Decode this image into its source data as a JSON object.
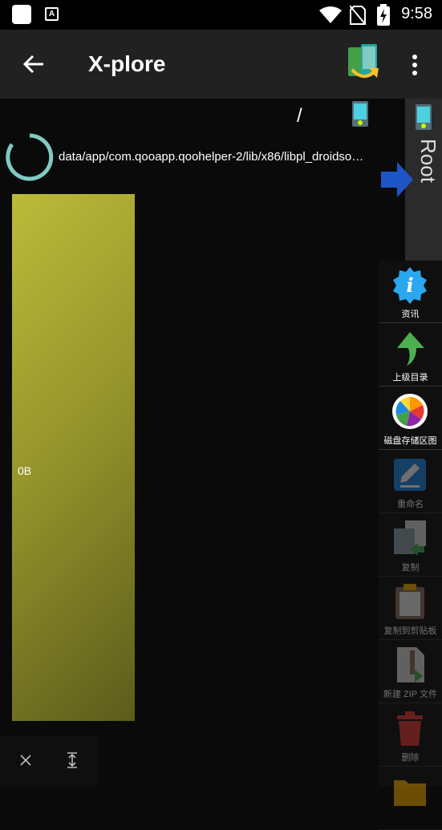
{
  "status_bar": {
    "time": "9:58",
    "notification_letter": "A"
  },
  "app_bar": {
    "title": "X-plore"
  },
  "path_bar": {
    "separator": "/"
  },
  "progress": {
    "path": "data/app/com.qooapp.qoohelper-2/lib/x86/libpl_droidso…"
  },
  "storage_bar": {
    "label": "0B",
    "color": "#b5b53a"
  },
  "side_tab": {
    "label": "Root"
  },
  "side_menu": [
    {
      "label": "资讯",
      "icon": "info-icon",
      "enabled": true
    },
    {
      "label": "上级目录",
      "icon": "up-arrow-icon",
      "enabled": true
    },
    {
      "label": "磁盘存储区图",
      "icon": "pie-chart-icon",
      "enabled": true
    },
    {
      "label": "重命名",
      "icon": "rename-icon",
      "enabled": false
    },
    {
      "label": "复制",
      "icon": "copy-icon",
      "enabled": false
    },
    {
      "label": "复制到剪贴板",
      "icon": "clipboard-icon",
      "enabled": false
    },
    {
      "label": "新建 ZIP 文件",
      "icon": "zip-icon",
      "enabled": false
    },
    {
      "label": "删除",
      "icon": "trash-icon",
      "enabled": false
    },
    {
      "label": "",
      "icon": "folder-icon",
      "enabled": false
    }
  ]
}
